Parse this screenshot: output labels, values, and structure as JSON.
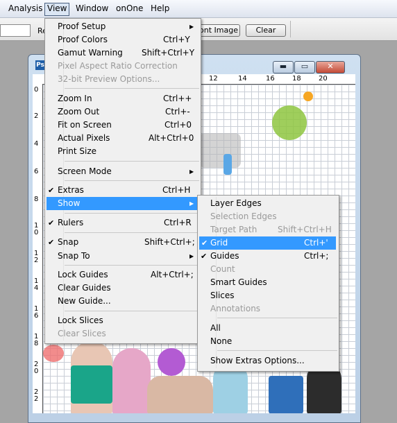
{
  "menubar": {
    "items": [
      {
        "label": "Analysis"
      },
      {
        "label": "View"
      },
      {
        "label": "Window"
      },
      {
        "label": "onOne"
      },
      {
        "label": "Help"
      }
    ]
  },
  "options_bar": {
    "label_partial": "Re",
    "front_image_button": "ont Image",
    "clear_button": "Clear"
  },
  "document": {
    "app_icon_text": "Ps",
    "minimize_glyph": "▬",
    "maximize_glyph": "▭",
    "close_glyph": "✕",
    "ruler_top": [
      "12",
      "14",
      "16",
      "18",
      "20"
    ],
    "ruler_left": [
      "0",
      "2",
      "4",
      "6",
      "8",
      "1 0",
      "1 2",
      "1 4",
      "1 6",
      "1 8",
      "2 0",
      "2 2"
    ]
  },
  "view_menu": {
    "items": [
      {
        "label": "Proof Setup",
        "submenu": true
      },
      {
        "label": "Proof Colors",
        "shortcut": "Ctrl+Y"
      },
      {
        "label": "Gamut Warning",
        "shortcut": "Shift+Ctrl+Y"
      },
      {
        "label": "Pixel Aspect Ratio Correction",
        "disabled": true
      },
      {
        "label": "32-bit Preview Options...",
        "disabled": true
      },
      {
        "label": "Zoom In",
        "shortcut": "Ctrl++"
      },
      {
        "label": "Zoom Out",
        "shortcut": "Ctrl+-"
      },
      {
        "label": "Fit on Screen",
        "shortcut": "Ctrl+0"
      },
      {
        "label": "Actual Pixels",
        "shortcut": "Alt+Ctrl+0"
      },
      {
        "label": "Print Size"
      },
      {
        "label": "Screen Mode",
        "submenu": true
      },
      {
        "label": "Extras",
        "shortcut": "Ctrl+H",
        "checked": true
      },
      {
        "label": "Show",
        "submenu": true,
        "highlighted": true
      },
      {
        "label": "Rulers",
        "shortcut": "Ctrl+R",
        "checked": true
      },
      {
        "label": "Snap",
        "shortcut": "Shift+Ctrl+;",
        "checked": true
      },
      {
        "label": "Snap To",
        "submenu": true
      },
      {
        "label": "Lock Guides",
        "shortcut": "Alt+Ctrl+;"
      },
      {
        "label": "Clear Guides"
      },
      {
        "label": "New Guide..."
      },
      {
        "label": "Lock Slices"
      },
      {
        "label": "Clear Slices",
        "disabled": true
      }
    ]
  },
  "show_submenu": {
    "items": [
      {
        "label": "Layer Edges"
      },
      {
        "label": "Selection Edges",
        "disabled": true
      },
      {
        "label": "Target Path",
        "shortcut": "Shift+Ctrl+H",
        "disabled": true
      },
      {
        "label": "Grid",
        "shortcut": "Ctrl+'",
        "checked": true,
        "highlighted": true
      },
      {
        "label": "Guides",
        "shortcut": "Ctrl+;",
        "checked": true
      },
      {
        "label": "Count",
        "disabled": true
      },
      {
        "label": "Smart Guides"
      },
      {
        "label": "Slices"
      },
      {
        "label": "Annotations",
        "disabled": true
      },
      {
        "label": "All"
      },
      {
        "label": "None"
      },
      {
        "label": "Show Extras Options..."
      }
    ]
  },
  "colors": {
    "highlight": "#3399ff",
    "menu_bg": "#f0f0f0",
    "disabled_text": "#9a9a9a"
  }
}
